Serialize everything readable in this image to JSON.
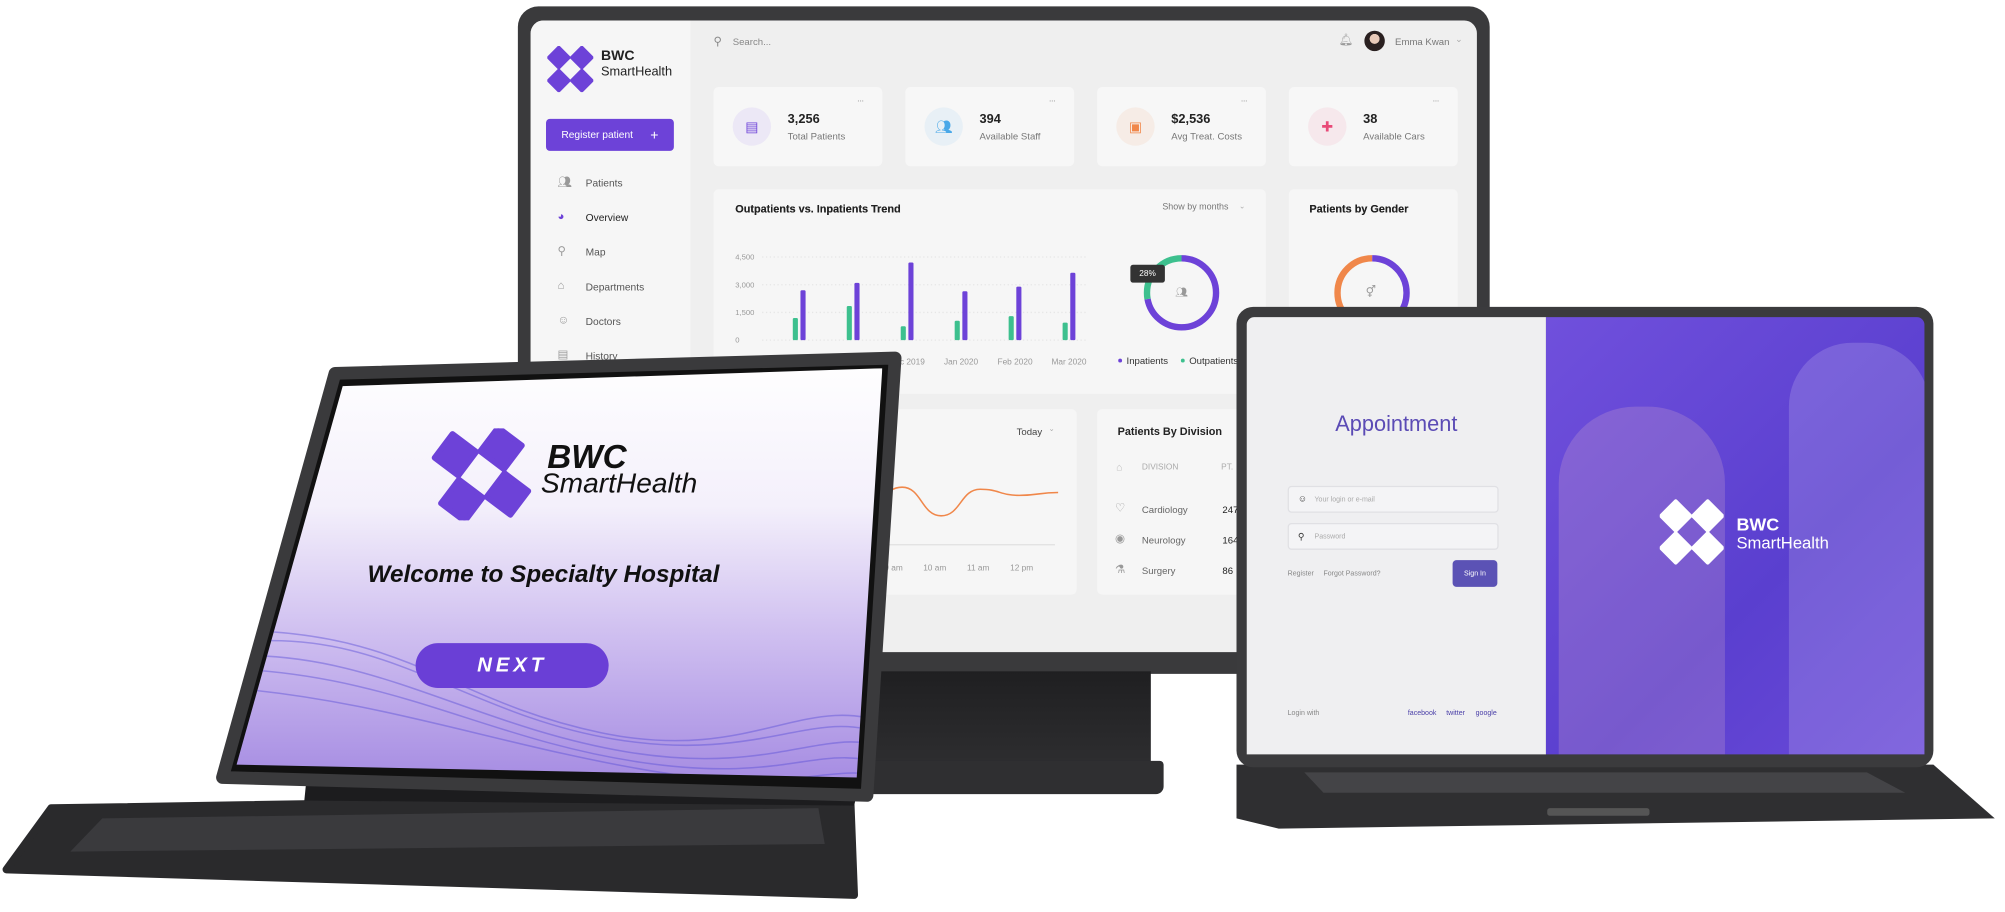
{
  "dashboard": {
    "brand": {
      "line1": "BWC",
      "line2": "SmartHealth"
    },
    "search_placeholder": "Search...",
    "user_name": "Emma Kwan",
    "register_button": "Register patient",
    "register_icon": "+",
    "nav": [
      {
        "label": "Patients",
        "icon": "users-icon"
      },
      {
        "label": "Overview",
        "icon": "pie-chart-icon",
        "active": true
      },
      {
        "label": "Map",
        "icon": "map-pin-icon"
      },
      {
        "label": "Departments",
        "icon": "home-icon"
      },
      {
        "label": "Doctors",
        "icon": "doctor-icon"
      },
      {
        "label": "History",
        "icon": "history-icon"
      }
    ],
    "stats": [
      {
        "value": "3,256",
        "label": "Total Patients",
        "icon": "bed-icon",
        "color": "#6d42d8",
        "bg": "#ece8f6"
      },
      {
        "value": "394",
        "label": "Available Staff",
        "icon": "staff-icon",
        "color": "#4aa8e8",
        "bg": "#e8f0f6"
      },
      {
        "value": "$2,536",
        "label": "Avg Treat. Costs",
        "icon": "wallet-icon",
        "color": "#f0874a",
        "bg": "#f6ece6"
      },
      {
        "value": "38",
        "label": "Available Cars",
        "icon": "ambulance-icon",
        "color": "#e84a78",
        "bg": "#f6e8ec"
      }
    ],
    "more_label": "···",
    "trend": {
      "title": "Outpatients vs. Inpatients Trend",
      "filter": "Show by months",
      "donut_badge": "28%"
    },
    "gender": {
      "title": "Patients by Gender"
    },
    "today": {
      "filter": "Today"
    },
    "division": {
      "title": "Patients By Division",
      "headers": [
        "DIVISION",
        "PT."
      ],
      "rows": [
        {
          "name": "Cardiology",
          "value": "247",
          "icon": "heart-icon"
        },
        {
          "name": "Neurology",
          "value": "164",
          "icon": "brain-icon"
        },
        {
          "name": "Surgery",
          "value": "86",
          "icon": "surgery-icon"
        }
      ]
    }
  },
  "chart_data": [
    {
      "type": "bar",
      "title": "Outpatients vs. Inpatients Trend",
      "categories": [
        "",
        "",
        "Dec 2019",
        "Jan 2020",
        "Feb 2020",
        "Mar 2020"
      ],
      "yticks": [
        "4,500",
        "3,000",
        "1,500",
        "0"
      ],
      "ylim": [
        0,
        4500
      ],
      "grid": true,
      "legend": "bottom",
      "series": [
        {
          "name": "Outpatients",
          "color": "#3dc08e",
          "values": [
            1200,
            1850,
            750,
            1050,
            1300,
            950
          ]
        },
        {
          "name": "Inpatients",
          "color": "#6d42d8",
          "values": [
            2700,
            3100,
            4200,
            2650,
            2900,
            3650
          ]
        }
      ]
    },
    {
      "type": "pie",
      "donut": true,
      "segments": [
        {
          "name": "Inpatients",
          "value": 72,
          "color": "#6d42d8"
        },
        {
          "name": "Outpatients",
          "value": 28,
          "color": "#3dc08e"
        }
      ]
    },
    {
      "type": "pie",
      "title": "Patients by Gender",
      "donut": true,
      "segments": [
        {
          "value": 50,
          "color": "#f0874a"
        },
        {
          "value": 50,
          "color": "#6d42d8"
        }
      ]
    },
    {
      "type": "line",
      "categories": [
        "09 am",
        "10 am",
        "11 am",
        "12 pm"
      ],
      "color": "#f0874a",
      "values": [
        0.2,
        0.75,
        0.05,
        0.7,
        0.55,
        0.62
      ]
    }
  ],
  "laptop": {
    "title": "Appointment",
    "login_placeholder": "Your login or e-mail",
    "password_placeholder": "Password",
    "register": "Register",
    "forgot": "Forgot Password?",
    "sign_in": "Sign In",
    "login_with": "Login with",
    "socials": [
      "facebook",
      "twitter",
      "google"
    ],
    "brand": {
      "line1": "BWC",
      "line2": "SmartHealth"
    }
  },
  "tablet": {
    "brand": {
      "line1": "BWC",
      "line2": "SmartHealth"
    },
    "welcome": "Welcome to Specialty Hospital",
    "next": "NEXT"
  },
  "colors": {
    "accent": "#6d42d8",
    "laptop_accent": "#5b4bb5"
  }
}
